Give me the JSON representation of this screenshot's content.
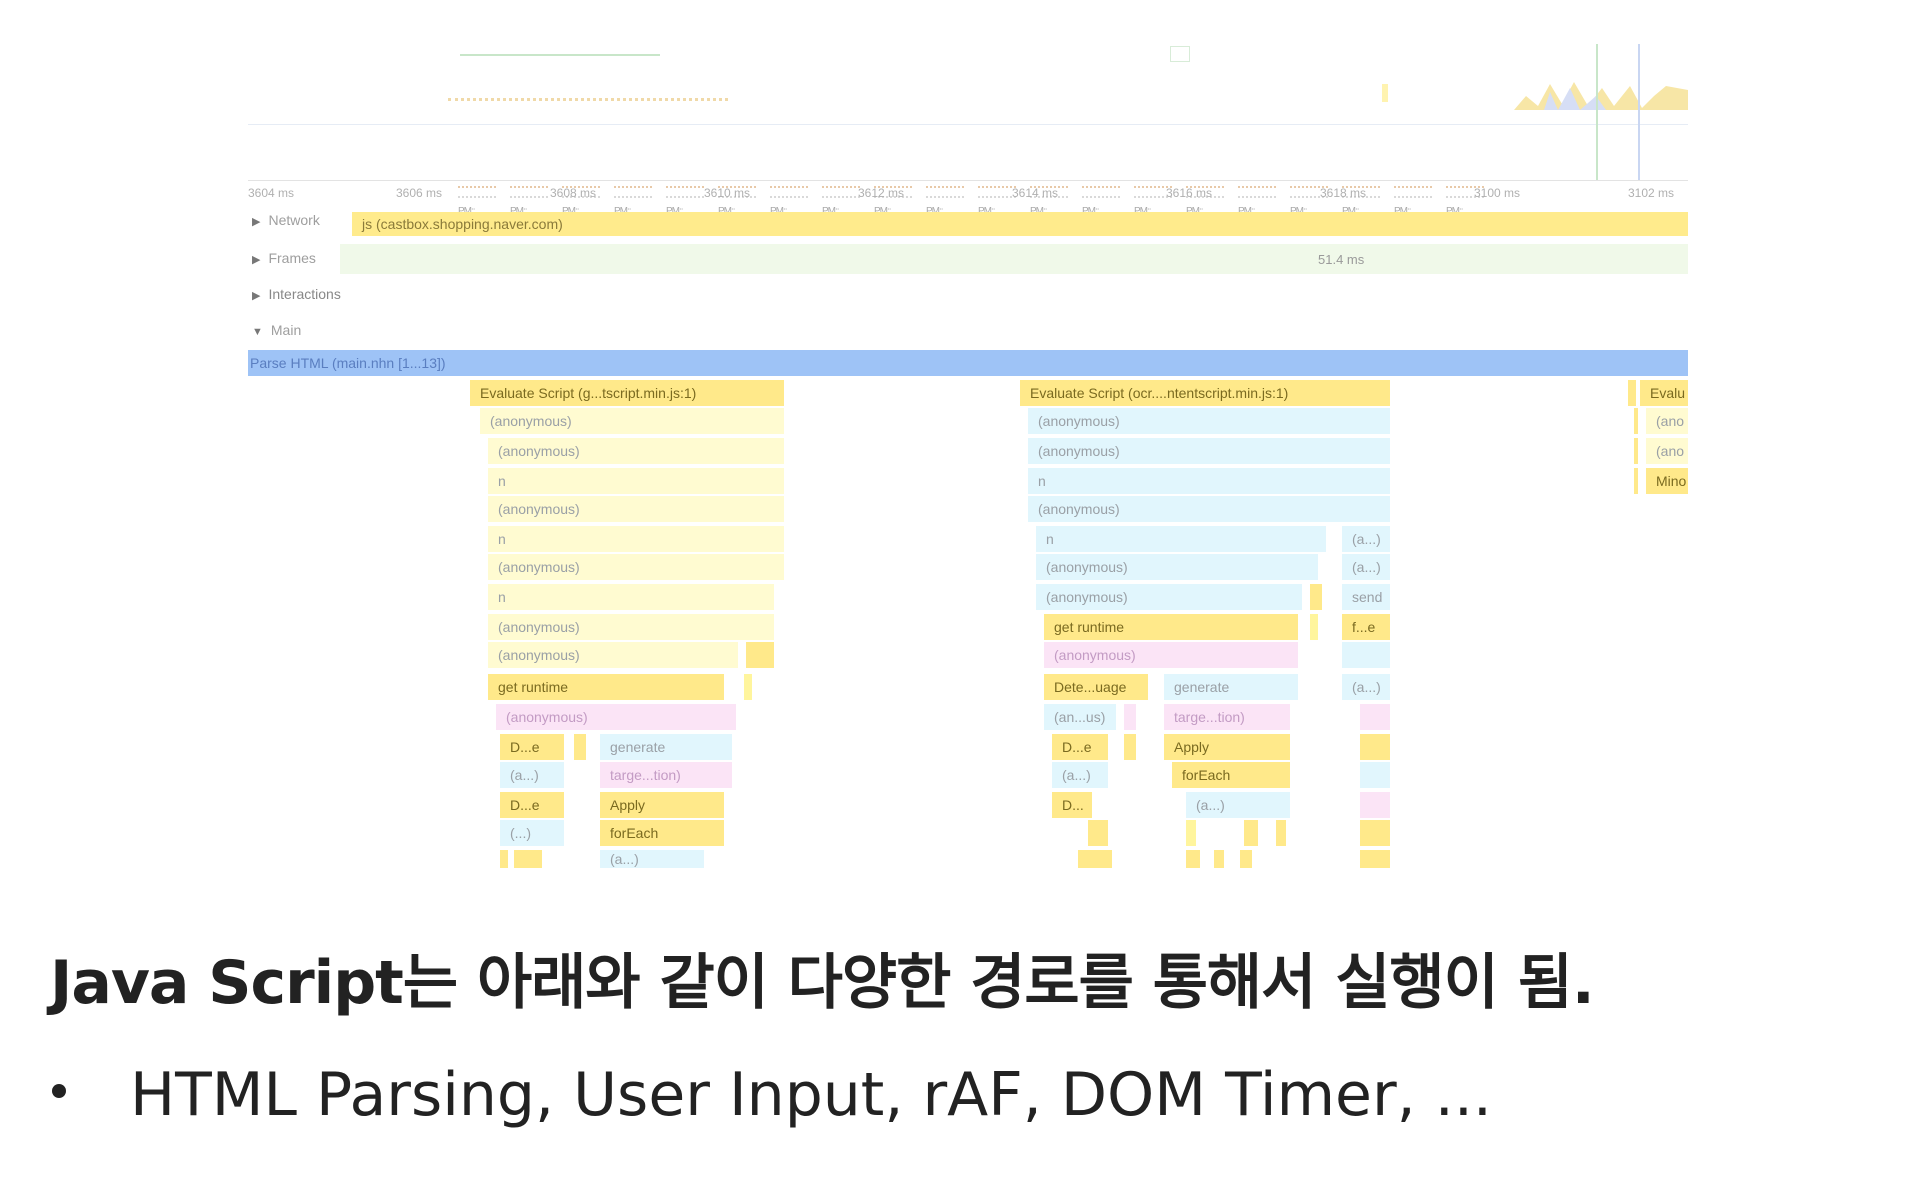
{
  "timeline": {
    "time_ticks": [
      "3604 ms",
      "3606 ms",
      "3608 ms",
      "3610 ms",
      "3612 ms",
      "3614 ms",
      "3616 ms",
      "3618 ms",
      "3100 ms",
      "3102 ms"
    ],
    "tracks": {
      "network_label": "Network",
      "network_item": "js (castbox.shopping.naver.com)",
      "frames_label": "Frames",
      "frames_value": "51.4 ms",
      "interactions_label": "Interactions",
      "main_label": "Main"
    },
    "parse_html": "Parse HTML (main.nhn [1...13])",
    "flame_left": {
      "evaluate": "Evaluate Script (g...tscript.min.js:1)",
      "rows": [
        "(anonymous)",
        "(anonymous)",
        "n",
        "(anonymous)",
        "n",
        "(anonymous)",
        "n",
        "(anonymous)",
        "(anonymous)"
      ],
      "get_runtime": "get runtime",
      "anon_pink": "(anonymous)",
      "de": "D...e",
      "generate": "generate",
      "a_short": "(a...)",
      "target_fn": "targe...tion)",
      "de2": "D...e",
      "apply": "Apply",
      "paren": "(...)",
      "foreach": "forEach",
      "a_short2": "(a...)"
    },
    "flame_right": {
      "evaluate": "Evaluate Script (ocr....ntentscript.min.js:1)",
      "rows": [
        "(anonymous)",
        "(anonymous)",
        "n",
        "(anonymous)"
      ],
      "n2": "n",
      "anon2": "(anonymous)",
      "anon3": "(anonymous)",
      "get_runtime": "get runtime",
      "anon_pink": "(anonymous)",
      "dete_usage": "Dete...uage",
      "generate": "generate",
      "an_us": "(an...us)",
      "target_fn": "targe...tion)",
      "de": "D...e",
      "apply": "Apply",
      "a1": "(a...)",
      "foreach": "forEach",
      "d_short": "D...",
      "a2": "(a...)",
      "side_a1": "(a...)",
      "side_a2": "(a...)",
      "side_send": "send",
      "side_fe": "f...e",
      "side_a3": "(a...)"
    },
    "flame_far": {
      "evaluate": "Evalu",
      "r1": "(ano",
      "r2": "(ano",
      "r3": "Mino"
    }
  },
  "slide": {
    "heading": "Java Script는 아래와 같이 다양한 경로를 통해서 실행이 됨.",
    "bullet": "HTML Parsing, User Input, rAF, DOM Timer, ..."
  }
}
